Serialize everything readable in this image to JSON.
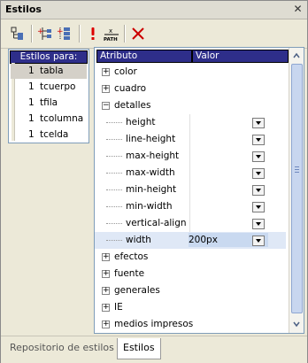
{
  "window": {
    "title": "Estilos",
    "close_glyph": "✕"
  },
  "toolbar": {
    "buttons": [
      "new-element-icon",
      "insert-style-icon",
      "add-style-icon",
      "important-icon",
      "xpath-icon",
      "delete-icon"
    ]
  },
  "left_panel": {
    "header": "Estilos para:",
    "items": [
      {
        "num": "1",
        "label": "tabla",
        "selected": true
      },
      {
        "num": "1",
        "label": "tcuerpo"
      },
      {
        "num": "1",
        "label": "tfila"
      },
      {
        "num": "1",
        "label": "tcolumna"
      },
      {
        "num": "1",
        "label": "tcelda"
      }
    ]
  },
  "right_panel": {
    "col_attr": "Atributo",
    "col_val": "Valor",
    "groups_top": [
      {
        "expander": "+",
        "label": "color"
      },
      {
        "expander": "+",
        "label": "cuadro"
      },
      {
        "expander": "−",
        "label": "detalles"
      }
    ],
    "detalles_children": [
      {
        "label": "height",
        "value": ""
      },
      {
        "label": "line-height",
        "value": ""
      },
      {
        "label": "max-height",
        "value": ""
      },
      {
        "label": "max-width",
        "value": ""
      },
      {
        "label": "min-height",
        "value": ""
      },
      {
        "label": "min-width",
        "value": ""
      },
      {
        "label": "vertical-align",
        "value": ""
      },
      {
        "label": "width",
        "value": "200px",
        "selected": true
      }
    ],
    "groups_bottom": [
      {
        "expander": "+",
        "label": "efectos"
      },
      {
        "expander": "+",
        "label": "fuente"
      },
      {
        "expander": "+",
        "label": "generales"
      },
      {
        "expander": "+",
        "label": "IE"
      },
      {
        "expander": "+",
        "label": "medios impresos"
      }
    ]
  },
  "tabs": [
    {
      "label": "Repositorio de estilos",
      "active": false
    },
    {
      "label": "Estilos",
      "active": true
    }
  ],
  "colors": {
    "header_bg": "#2e2e8a",
    "selected_row": "#dfe8f6",
    "delete": "#cc0000",
    "important": "#dd0000"
  }
}
